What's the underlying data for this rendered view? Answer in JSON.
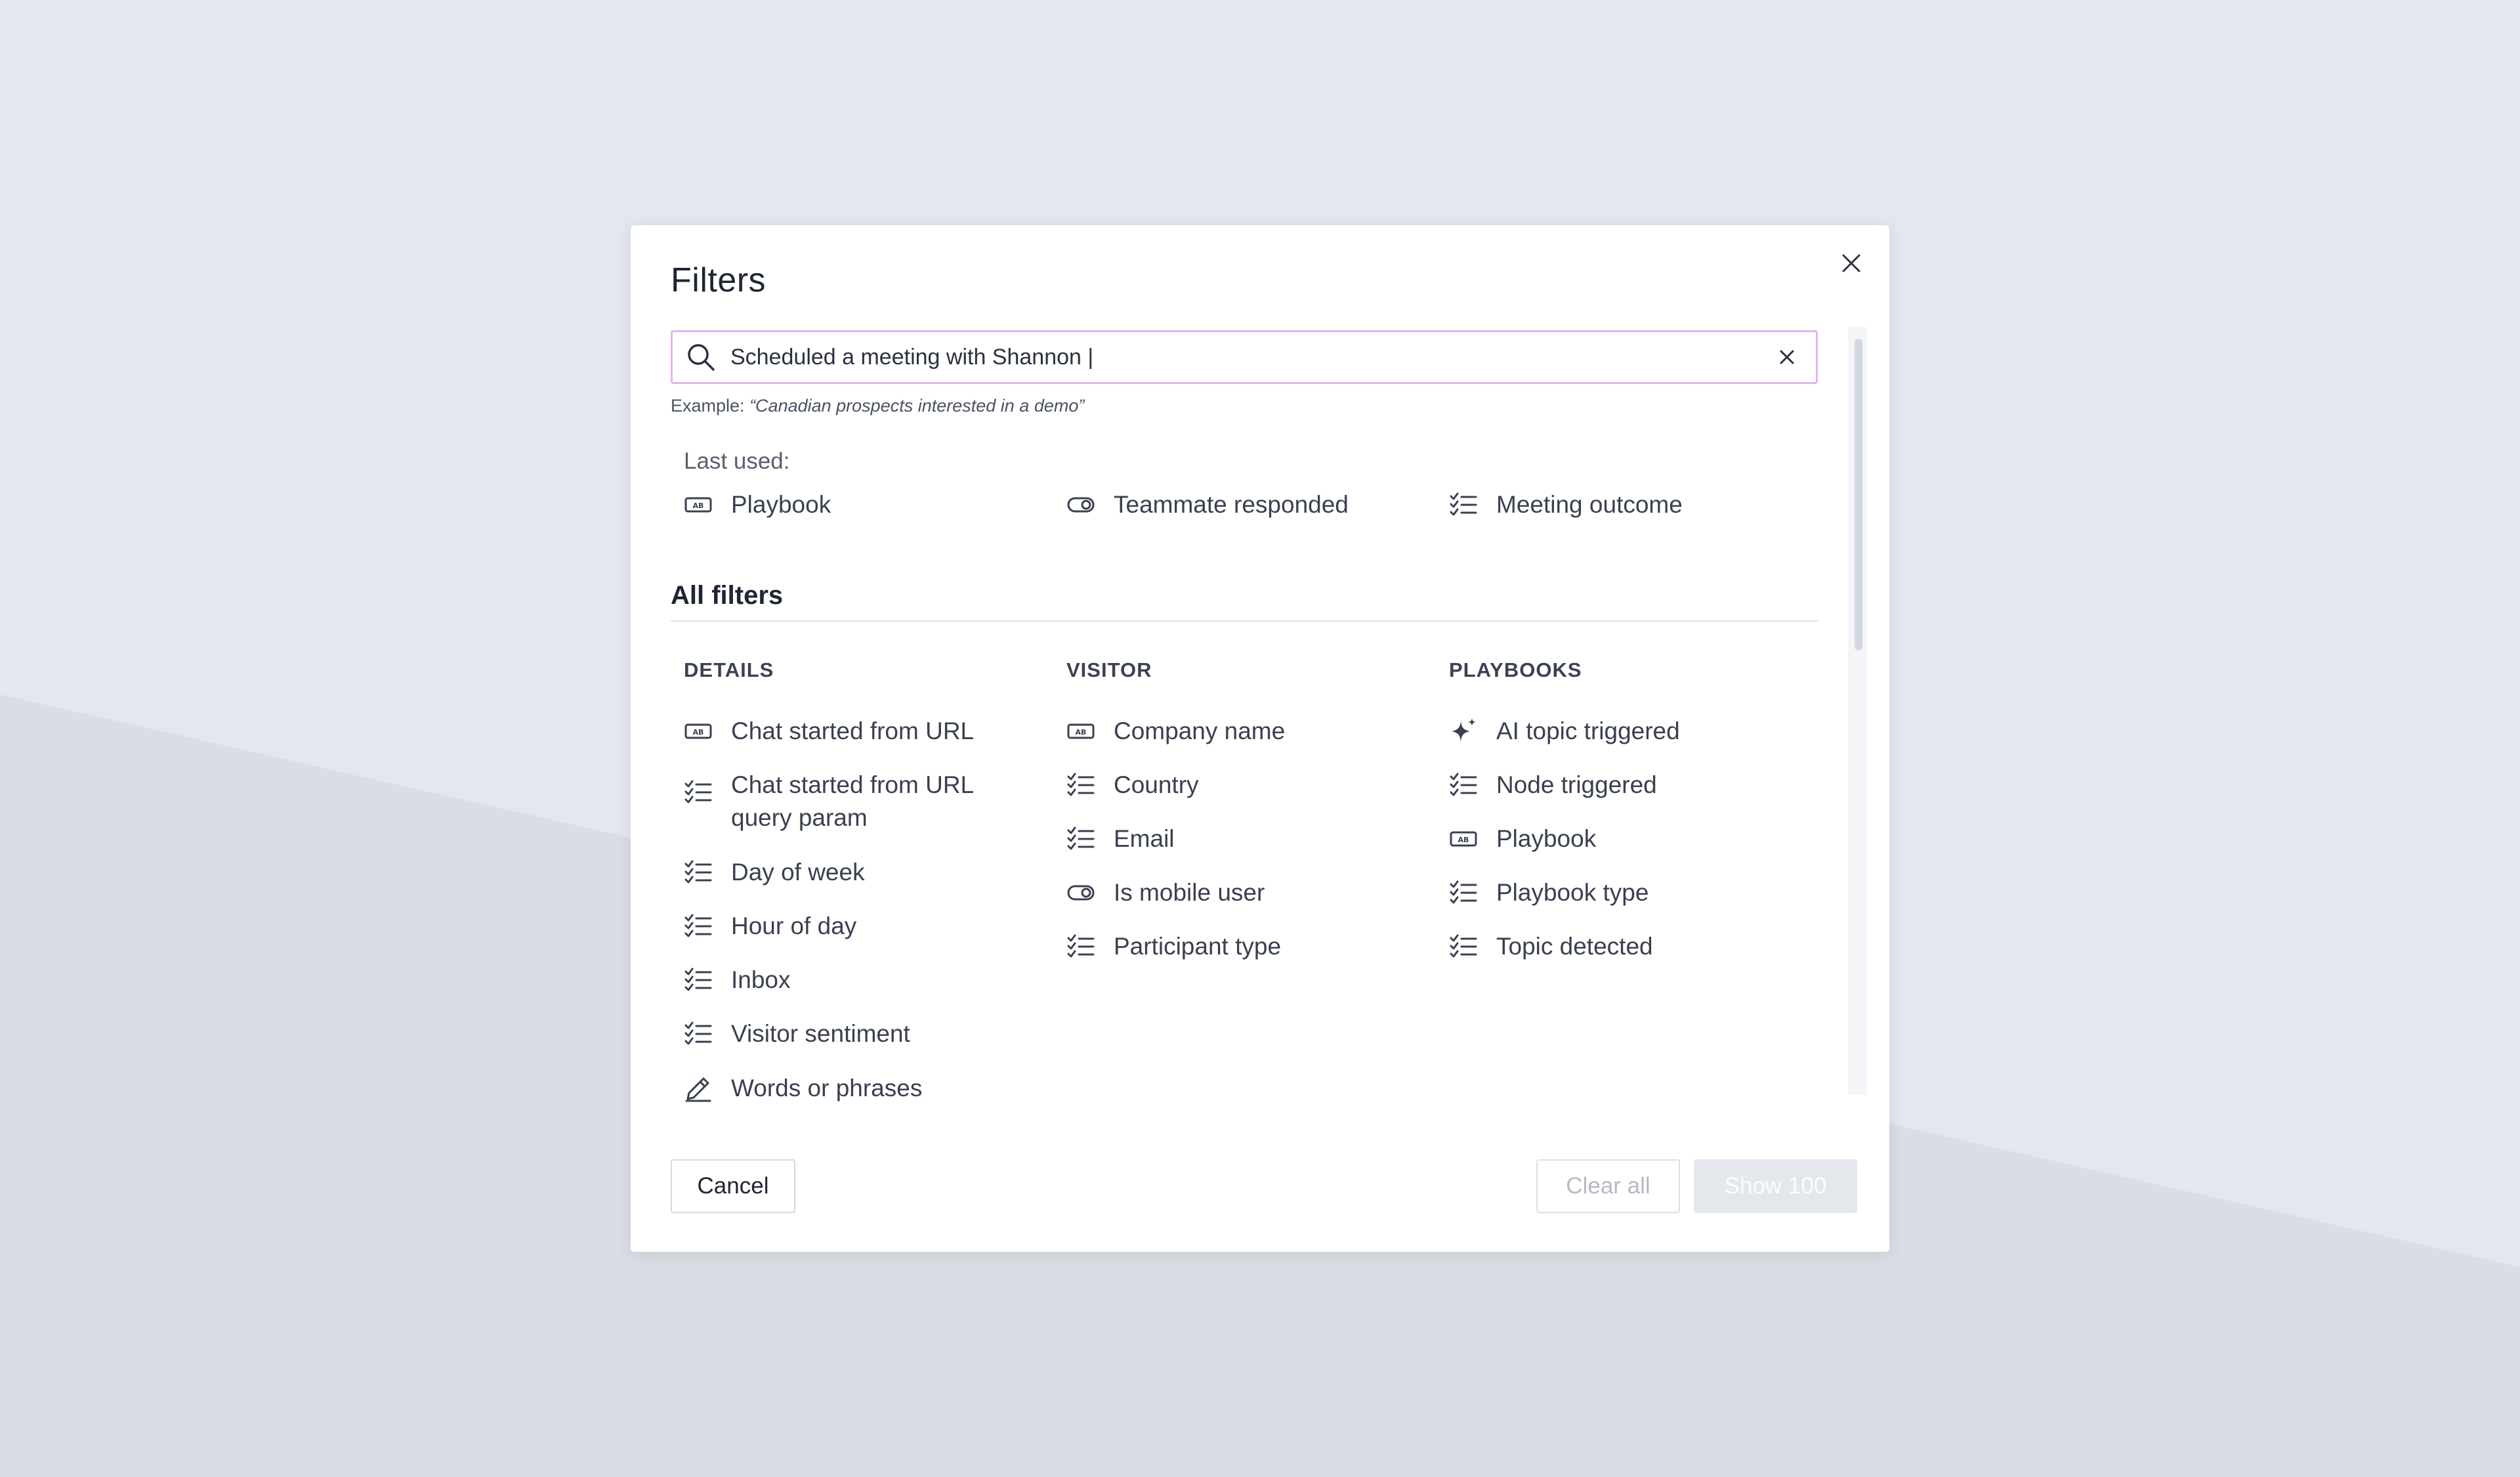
{
  "modal": {
    "title": "Filters",
    "search": {
      "value": "Scheduled a meeting with Shannon |",
      "example_prefix": "Example: ",
      "example_text": "“Canadian prospects interested in a demo”"
    },
    "last_used": {
      "label": "Last used:",
      "items": [
        {
          "label": "Playbook",
          "icon": "text-field-icon"
        },
        {
          "label": "Teammate responded",
          "icon": "toggle-icon"
        },
        {
          "label": "Meeting outcome",
          "icon": "checklist-icon"
        }
      ]
    },
    "all_filters": {
      "heading": "All filters",
      "columns": [
        {
          "heading": "DETAILS",
          "items": [
            {
              "label": "Chat started from URL",
              "icon": "text-field-icon"
            },
            {
              "label": "Chat started from URL query param",
              "icon": "checklist-icon"
            },
            {
              "label": "Day of week",
              "icon": "checklist-icon"
            },
            {
              "label": "Hour of day",
              "icon": "checklist-icon"
            },
            {
              "label": "Inbox",
              "icon": "checklist-icon"
            },
            {
              "label": "Visitor sentiment",
              "icon": "checklist-icon"
            },
            {
              "label": "Words or phrases",
              "icon": "pencil-icon"
            }
          ]
        },
        {
          "heading": "VISITOR",
          "items": [
            {
              "label": "Company name",
              "icon": "text-field-icon"
            },
            {
              "label": "Country",
              "icon": "checklist-icon"
            },
            {
              "label": "Email",
              "icon": "checklist-icon"
            },
            {
              "label": "Is mobile user",
              "icon": "toggle-icon"
            },
            {
              "label": "Participant type",
              "icon": "checklist-icon"
            }
          ]
        },
        {
          "heading": "PLAYBOOKS",
          "items": [
            {
              "label": "AI topic triggered",
              "icon": "sparkle-icon"
            },
            {
              "label": "Node triggered",
              "icon": "checklist-icon"
            },
            {
              "label": "Playbook",
              "icon": "text-field-icon"
            },
            {
              "label": "Playbook type",
              "icon": "checklist-icon"
            },
            {
              "label": "Topic detected",
              "icon": "checklist-icon"
            }
          ]
        }
      ]
    },
    "footer": {
      "cancel_label": "Cancel",
      "clear_all_label": "Clear all",
      "show_label": "Show 100"
    }
  },
  "colors": {
    "search_border": "#e3b4ef",
    "background": "#e3e7ee",
    "disabled_button": "#e4e7ec"
  }
}
